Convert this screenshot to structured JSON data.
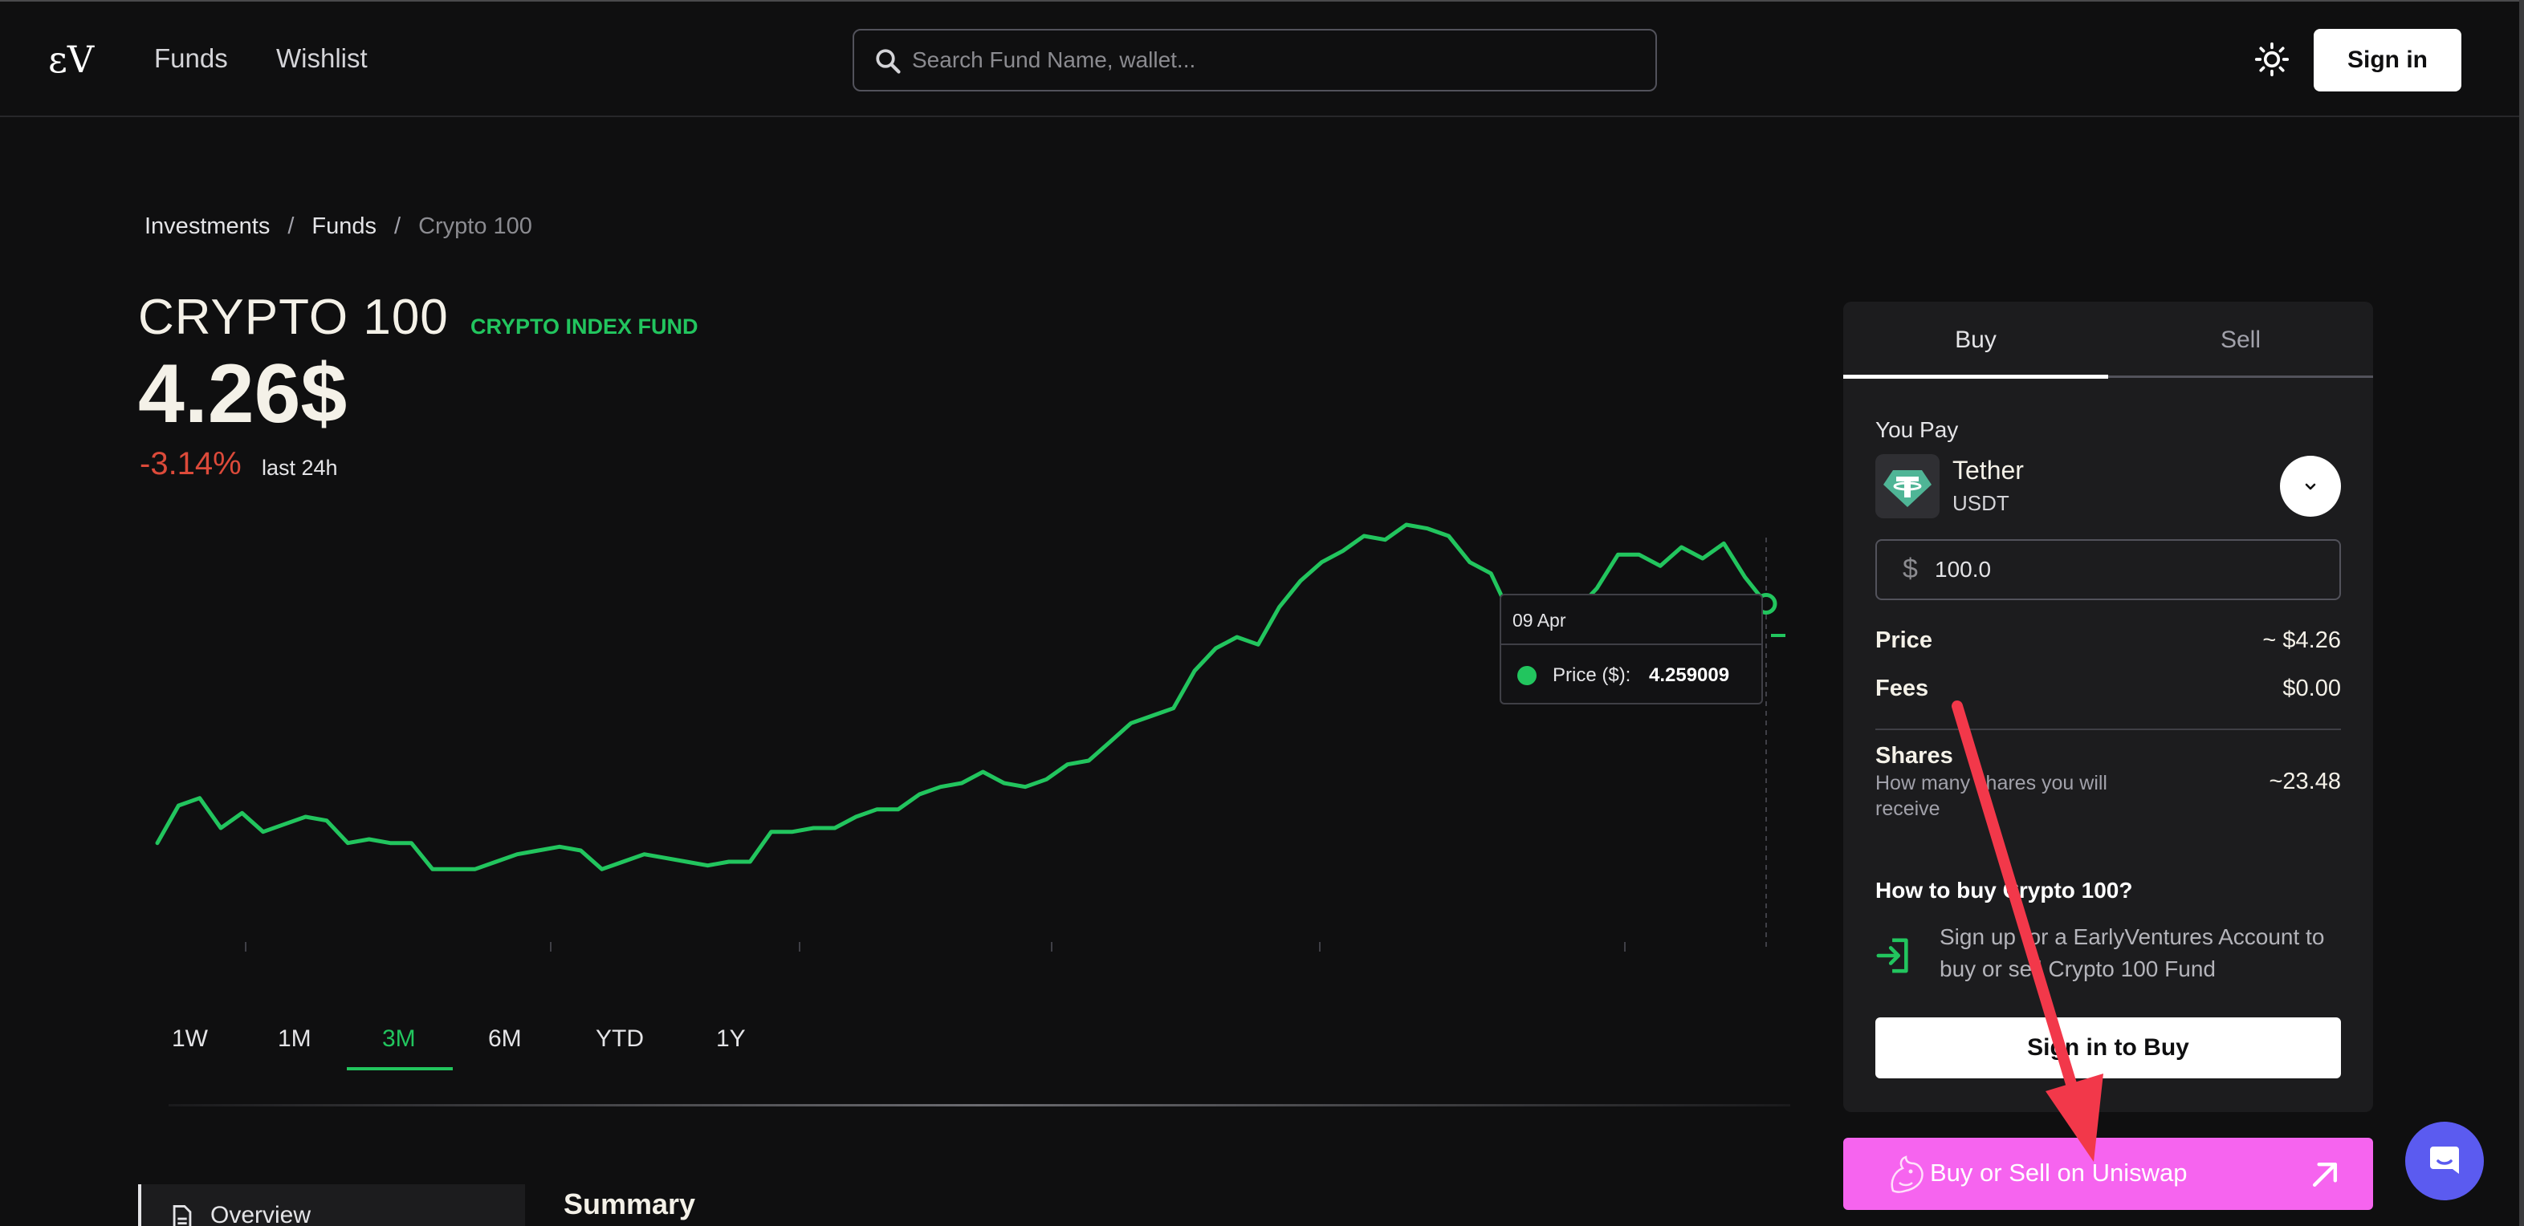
{
  "header": {
    "logo_text": "εV",
    "nav": [
      "Funds",
      "Wishlist"
    ],
    "search_placeholder": "Search Fund Name, wallet...",
    "signin_label": "Sign in"
  },
  "breadcrumb": {
    "items": [
      "Investments",
      "Funds"
    ],
    "separator": "/",
    "current": "Crypto 100"
  },
  "fund": {
    "name": "CRYPTO 100",
    "tag": "CRYPTO INDEX FUND",
    "price": "4.26$",
    "change": "-3.14%",
    "change_label": "last 24h"
  },
  "chart_data": {
    "type": "line",
    "title": "",
    "xlabel": "",
    "ylabel": "",
    "color": "#22c55e",
    "ylim": [
      3.3,
      4.5
    ],
    "grid": false,
    "series": [
      {
        "values": [
          3.62,
          3.72,
          3.74,
          3.66,
          3.7,
          3.65,
          3.67,
          3.69,
          3.68,
          3.62,
          3.63,
          3.62,
          3.62,
          3.55,
          3.55,
          3.55,
          3.57,
          3.59,
          3.6,
          3.61,
          3.6,
          3.55,
          3.57,
          3.59,
          3.58,
          3.57,
          3.56,
          3.57,
          3.57,
          3.65,
          3.65,
          3.66,
          3.66,
          3.69,
          3.71,
          3.71,
          3.75,
          3.77,
          3.78,
          3.81,
          3.78,
          3.77,
          3.79,
          3.83,
          3.84,
          3.89,
          3.94,
          3.96,
          3.98,
          4.08,
          4.14,
          4.17,
          4.15,
          4.25,
          4.32,
          4.37,
          4.4,
          4.44,
          4.43,
          4.47,
          4.46,
          4.44,
          4.37,
          4.34,
          4.22,
          4.26,
          4.21,
          4.24,
          4.3,
          4.39,
          4.39,
          4.36,
          4.41,
          4.38,
          4.42,
          4.33,
          4.259009
        ]
      }
    ],
    "tooltip": {
      "date": "09 Apr",
      "label": "Price ($):",
      "value": "4.259009"
    }
  },
  "ranges": {
    "items": [
      "1W",
      "1M",
      "3M",
      "6M",
      "YTD",
      "1Y"
    ],
    "active": "3M"
  },
  "sections": {
    "overview_label": "Overview",
    "summary_title": "Summary"
  },
  "trade": {
    "tab_buy": "Buy",
    "tab_sell": "Sell",
    "you_pay": "You Pay",
    "token_name": "Tether",
    "token_symbol": "USDT",
    "currency_symbol": "$",
    "amount": "100.0",
    "price_label": "Price",
    "price_value": "~ $4.26",
    "fees_label": "Fees",
    "fees_value": "$0.00",
    "shares_label": "Shares",
    "shares_desc": "How many shares you will receive",
    "shares_value": "~23.48",
    "howto_title": "How to buy Crypto 100?",
    "signup_text": "Sign up for a EarlyVentures Account to buy or sell Crypto 100 Fund",
    "signin_buy_label": "Sign in to Buy",
    "uniswap_label": "Buy or Sell on Uniswap"
  },
  "colors": {
    "accent_green": "#22c55e",
    "negative_red": "#dc4a3a",
    "uniswap_pink": "#f664ef",
    "annotation_red": "#f2384a",
    "chat_blue": "#5b5bf0"
  }
}
